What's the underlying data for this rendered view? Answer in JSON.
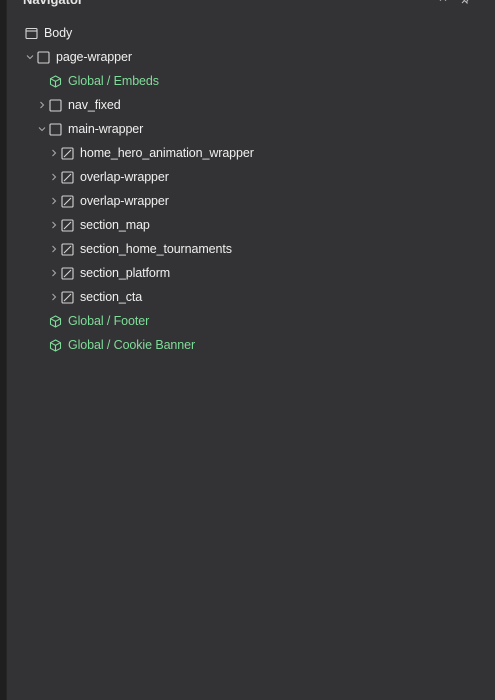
{
  "navigator": {
    "title": "Navigator",
    "collapse_icon": "chevron-up-icon",
    "pin_icon": "pin-icon"
  },
  "tree": {
    "body": "Body",
    "page_wrapper": "page-wrapper",
    "global_embeds": "Global / Embeds",
    "nav_fixed": "nav_fixed",
    "main_wrapper": "main-wrapper",
    "home_hero": "home_hero_animation_wrapper",
    "overlap_1": "overlap-wrapper",
    "overlap_2": "overlap-wrapper",
    "section_map": "section_map",
    "section_home_tournaments": "section_home_tournaments",
    "section_platform": "section_platform",
    "section_cta": "section_cta",
    "global_footer": "Global / Footer",
    "global_cookie": "Global / Cookie Banner"
  },
  "colors": {
    "panel_bg": "#333234",
    "text": "#f0f0f0",
    "symbol_green": "#7fdc9a"
  }
}
